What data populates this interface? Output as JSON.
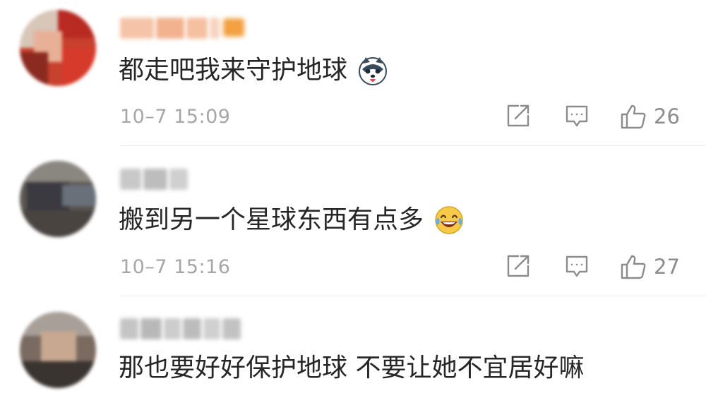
{
  "comments": [
    {
      "text": "都走吧我来守护地球",
      "emoji": "husky-dog-emoji",
      "timestamp": "10–7 15:09",
      "likes": "26",
      "username_style": "orange-vip"
    },
    {
      "text": "搬到另一个星球东西有点多",
      "emoji": "laugh-cry-emoji",
      "timestamp": "10–7 15:16",
      "likes": "27",
      "username_style": "gray"
    },
    {
      "text": "那也要好好保护地球 不要让她不宜居好嘛",
      "emoji": "",
      "username_style": "gray"
    }
  ],
  "icons": {
    "share": "share-icon",
    "reply": "comment-icon",
    "like": "thumbs-up-icon"
  },
  "colors": {
    "text": "#262626",
    "meta": "#a6a6a6",
    "icon": "#8c8c8c",
    "vip_name": "#f0a878"
  }
}
